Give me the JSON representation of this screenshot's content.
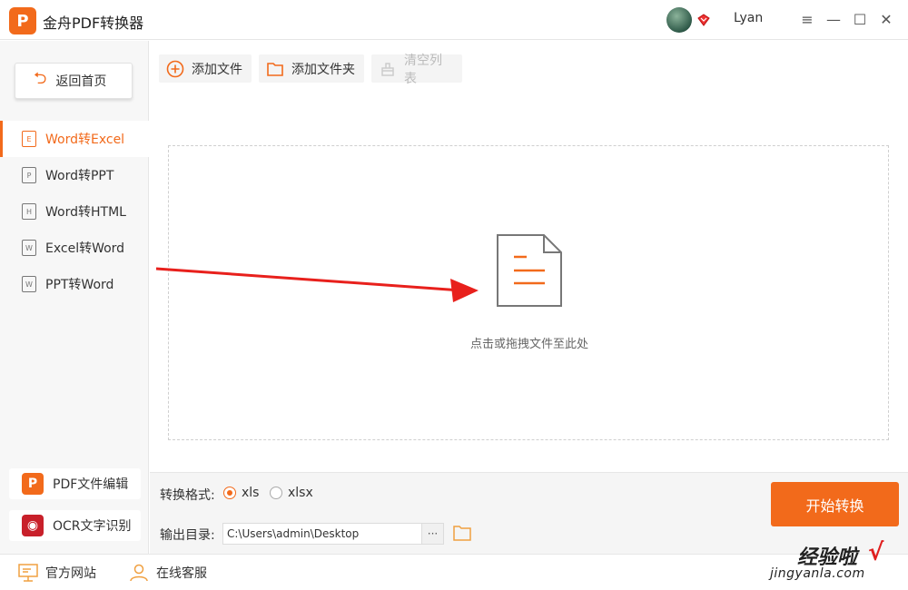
{
  "app": {
    "title": "金舟PDF转换器",
    "logo_letter": "P",
    "accent_color": "#f26a1b",
    "username": "Lyan"
  },
  "window_controls": {
    "menu_icon": "≡",
    "minimize_icon": "—",
    "maximize_icon": "☐",
    "close_icon": "✕"
  },
  "sidebar": {
    "back_label": "返回首页",
    "items": [
      {
        "label": "Word转Excel",
        "icon_letter": "E",
        "active": true
      },
      {
        "label": "Word转PPT",
        "icon_letter": "P",
        "active": false
      },
      {
        "label": "Word转HTML",
        "icon_letter": "H",
        "active": false
      },
      {
        "label": "Excel转Word",
        "icon_letter": "W",
        "active": false
      },
      {
        "label": "PPT转Word",
        "icon_letter": "W",
        "active": false
      }
    ],
    "tools": [
      {
        "label": "PDF文件编辑",
        "icon_letter": "P"
      },
      {
        "label": "OCR文字识别",
        "icon_letter": "◉"
      }
    ]
  },
  "toolbar": {
    "add_file": "添加文件",
    "add_folder": "添加文件夹",
    "clear_list": "清空列表"
  },
  "dropzone": {
    "hint": "点击或拖拽文件至此处"
  },
  "settings": {
    "format_label": "转换格式:",
    "formats": [
      {
        "label": "xls",
        "checked": true
      },
      {
        "label": "xlsx",
        "checked": false
      }
    ],
    "output_label": "输出目录:",
    "output_path": "C:\\Users\\admin\\Desktop",
    "browse_label": "···",
    "start_label": "开始转换"
  },
  "footer": {
    "website": "官方网站",
    "support": "在线客服"
  },
  "watermark": {
    "main": "经验啦",
    "check": "√",
    "sub": "jingyanla.com"
  }
}
